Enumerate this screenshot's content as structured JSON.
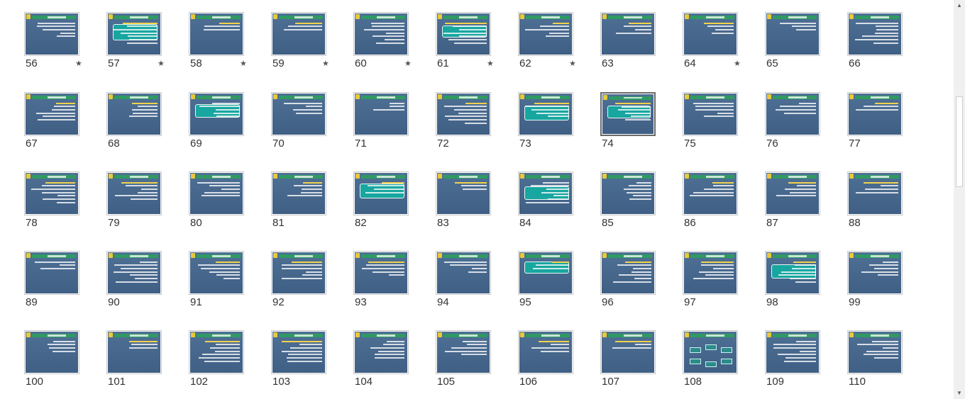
{
  "slides": [
    {
      "n": "56",
      "star": true
    },
    {
      "n": "57",
      "star": true
    },
    {
      "n": "58",
      "star": true
    },
    {
      "n": "59",
      "star": true
    },
    {
      "n": "60",
      "star": true
    },
    {
      "n": "61",
      "star": true
    },
    {
      "n": "62",
      "star": true
    },
    {
      "n": "63",
      "star": false
    },
    {
      "n": "64",
      "star": true
    },
    {
      "n": "65",
      "star": false
    },
    {
      "n": "66",
      "star": false
    },
    {
      "n": "67",
      "star": false
    },
    {
      "n": "68",
      "star": false
    },
    {
      "n": "69",
      "star": false
    },
    {
      "n": "70",
      "star": false
    },
    {
      "n": "71",
      "star": false
    },
    {
      "n": "72",
      "star": false
    },
    {
      "n": "73",
      "star": false
    },
    {
      "n": "74",
      "star": false,
      "selected": true
    },
    {
      "n": "75",
      "star": false
    },
    {
      "n": "76",
      "star": false
    },
    {
      "n": "77",
      "star": false
    },
    {
      "n": "78",
      "star": false
    },
    {
      "n": "79",
      "star": false
    },
    {
      "n": "80",
      "star": false
    },
    {
      "n": "81",
      "star": false
    },
    {
      "n": "82",
      "star": false
    },
    {
      "n": "83",
      "star": false
    },
    {
      "n": "84",
      "star": false
    },
    {
      "n": "85",
      "star": false
    },
    {
      "n": "86",
      "star": false
    },
    {
      "n": "87",
      "star": false
    },
    {
      "n": "88",
      "star": false
    },
    {
      "n": "89",
      "star": false
    },
    {
      "n": "90",
      "star": false
    },
    {
      "n": "91",
      "star": false
    },
    {
      "n": "92",
      "star": false
    },
    {
      "n": "93",
      "star": false
    },
    {
      "n": "94",
      "star": false
    },
    {
      "n": "95",
      "star": false
    },
    {
      "n": "96",
      "star": false
    },
    {
      "n": "97",
      "star": false
    },
    {
      "n": "98",
      "star": false
    },
    {
      "n": "99",
      "star": false
    },
    {
      "n": "100",
      "star": false
    },
    {
      "n": "101",
      "star": false
    },
    {
      "n": "102",
      "star": false
    },
    {
      "n": "103",
      "star": false
    },
    {
      "n": "104",
      "star": false
    },
    {
      "n": "105",
      "star": false
    },
    {
      "n": "106",
      "star": false
    },
    {
      "n": "107",
      "star": false
    },
    {
      "n": "108",
      "star": false
    },
    {
      "n": "109",
      "star": false
    },
    {
      "n": "110",
      "star": false
    }
  ],
  "star_glyph": "★",
  "scrollbar": {
    "up_glyph": "▲",
    "down_glyph": "▼"
  },
  "colors": {
    "slide_bg": "#4b6b8e",
    "header_bar": "#2f9a63",
    "callout_box": "#18a6a0",
    "selection_border": "#6a6a6a"
  }
}
